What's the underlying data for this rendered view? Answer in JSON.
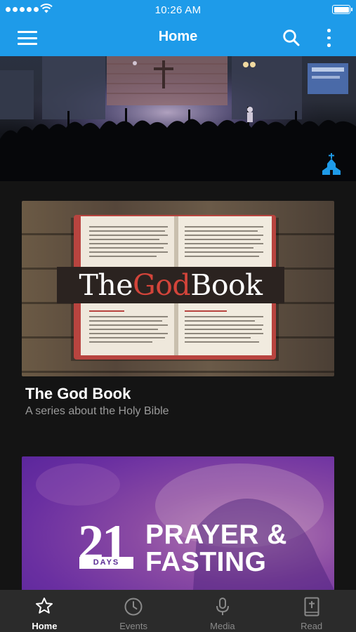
{
  "status_bar": {
    "time": "10:26 AM",
    "signal_icon": "signal-dots-icon",
    "wifi_icon": "wifi-icon",
    "battery_icon": "battery-full-icon"
  },
  "app_bar": {
    "title": "Home",
    "menu_icon": "hamburger-menu-icon",
    "search_icon": "search-icon",
    "more_icon": "more-vertical-icon",
    "background_color": "#1e9be9"
  },
  "hero": {
    "badge_icon": "church-icon"
  },
  "series": [
    {
      "image_text": {
        "part1": "The",
        "part2": "God",
        "part3": "Book"
      },
      "title": "The God Book",
      "subtitle": "A series about the Holy Bible"
    },
    {
      "image_text": {
        "number": "21",
        "days": "DAYS",
        "line1": "PRAYER &",
        "line2": "FASTING"
      }
    }
  ],
  "tab_bar": {
    "active_tab": "Home",
    "tabs": [
      {
        "label": "Home",
        "icon": "star-icon"
      },
      {
        "label": "Events",
        "icon": "clock-icon"
      },
      {
        "label": "Media",
        "icon": "microphone-icon"
      },
      {
        "label": "Read",
        "icon": "bible-icon"
      }
    ]
  }
}
